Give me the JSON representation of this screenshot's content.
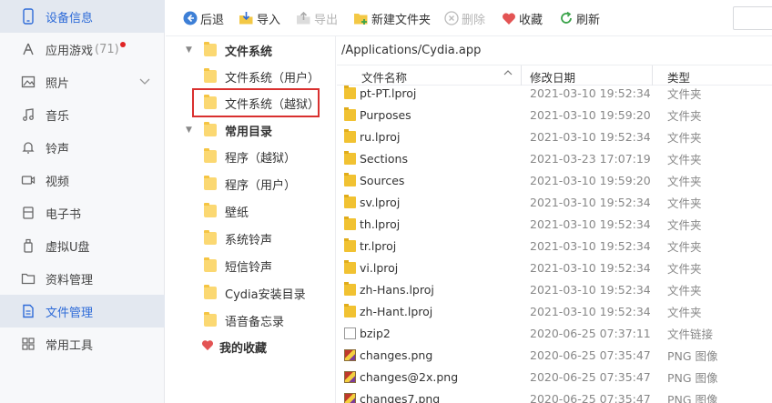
{
  "sidebar": {
    "items": [
      {
        "label": "设备信息",
        "icon": "phone-icon",
        "active": true
      },
      {
        "label": "应用游戏",
        "icon": "apps-icon",
        "count": "(71)",
        "badge": true
      },
      {
        "label": "照片",
        "icon": "photo-icon",
        "expandable": true
      },
      {
        "label": "音乐",
        "icon": "music-icon"
      },
      {
        "label": "铃声",
        "icon": "bell-icon"
      },
      {
        "label": "视频",
        "icon": "video-icon"
      },
      {
        "label": "电子书",
        "icon": "book-icon"
      },
      {
        "label": "虚拟U盘",
        "icon": "usb-icon"
      },
      {
        "label": "资料管理",
        "icon": "folder-icon"
      },
      {
        "label": "文件管理",
        "icon": "file-icon",
        "active": true
      },
      {
        "label": "常用工具",
        "icon": "tools-icon"
      }
    ]
  },
  "toolbar": {
    "back": "后退",
    "import": "导入",
    "export": "导出",
    "new_folder": "新建文件夹",
    "delete": "删除",
    "favorite": "收藏",
    "refresh": "刷新"
  },
  "tree": {
    "fs_root": "文件系统",
    "fs_user": "文件系统（用户）",
    "fs_jail": "文件系统（越狱）",
    "common_dirs": "常用目录",
    "prog_jail": "程序（越狱）",
    "prog_user": "程序（用户）",
    "wallpaper": "壁纸",
    "sys_ring": "系统铃声",
    "sms_ring": "短信铃声",
    "cydia_dir": "Cydia安装目录",
    "voice_memo": "语音备忘录",
    "favorites": "我的收藏"
  },
  "path": "/Applications/Cydia.app",
  "table": {
    "headers": {
      "name": "文件名称",
      "date": "修改日期",
      "type": "类型"
    },
    "rows": [
      {
        "name": "pt-PT.lproj",
        "date": "2021-03-10 19:52:34",
        "type": "文件夹",
        "kind": "folder"
      },
      {
        "name": "Purposes",
        "date": "2021-03-10 19:59:20",
        "type": "文件夹",
        "kind": "folder"
      },
      {
        "name": "ru.lproj",
        "date": "2021-03-10 19:52:34",
        "type": "文件夹",
        "kind": "folder"
      },
      {
        "name": "Sections",
        "date": "2021-03-23 17:07:19",
        "type": "文件夹",
        "kind": "folder"
      },
      {
        "name": "Sources",
        "date": "2021-03-10 19:59:20",
        "type": "文件夹",
        "kind": "folder"
      },
      {
        "name": "sv.lproj",
        "date": "2021-03-10 19:52:34",
        "type": "文件夹",
        "kind": "folder"
      },
      {
        "name": "th.lproj",
        "date": "2021-03-10 19:52:34",
        "type": "文件夹",
        "kind": "folder"
      },
      {
        "name": "tr.lproj",
        "date": "2021-03-10 19:52:34",
        "type": "文件夹",
        "kind": "folder"
      },
      {
        "name": "vi.lproj",
        "date": "2021-03-10 19:52:34",
        "type": "文件夹",
        "kind": "folder"
      },
      {
        "name": "zh-Hans.lproj",
        "date": "2021-03-10 19:52:34",
        "type": "文件夹",
        "kind": "folder"
      },
      {
        "name": "zh-Hant.lproj",
        "date": "2021-03-10 19:52:34",
        "type": "文件夹",
        "kind": "folder"
      },
      {
        "name": "bzip2",
        "date": "2020-06-25 07:37:11",
        "type": "文件链接",
        "kind": "file"
      },
      {
        "name": "changes.png",
        "date": "2020-06-25 07:35:47",
        "type": "PNG 图像",
        "kind": "png"
      },
      {
        "name": "changes@2x.png",
        "date": "2020-06-25 07:35:47",
        "type": "PNG 图像",
        "kind": "png"
      },
      {
        "name": "changes7.png",
        "date": "2020-06-25 07:35:47",
        "type": "PNG 图像",
        "kind": "png"
      }
    ]
  }
}
